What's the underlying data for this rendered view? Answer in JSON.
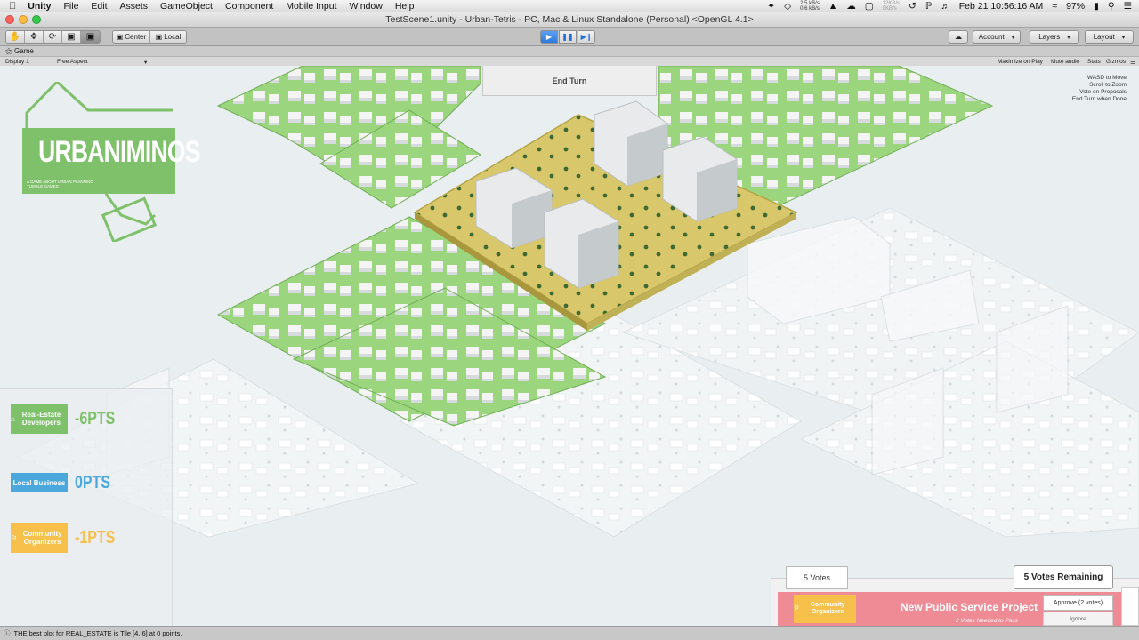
{
  "menubar": {
    "app_name": "Unity",
    "items": [
      "File",
      "Edit",
      "Assets",
      "GameObject",
      "Component",
      "Mobile Input",
      "Window",
      "Help"
    ],
    "net_up": "2.5 kB/s",
    "net_down": "0.6 kB/s",
    "disk_a": "12KB/s",
    "disk_b": "0KB/s",
    "battery": "97%",
    "datetime": "Feb 21  10:56:16 AM"
  },
  "window": {
    "title": "TestScene1.unity - Urban-Tetris - PC, Mac & Linux Standalone (Personal) <OpenGL 4.1>"
  },
  "toolbar": {
    "pivot_label": "Center",
    "space_label": "Local",
    "account_label": "Account",
    "layers_label": "Layers",
    "layout_label": "Layout",
    "tool_icons": [
      "hand-icon",
      "move-icon",
      "rotate-icon",
      "scale-icon",
      "rect-icon"
    ]
  },
  "game_view": {
    "tab_label": "Game",
    "display_label": "Display 1",
    "aspect_label": "Free Aspect",
    "maximize_label": "Maximize on Play",
    "mute_label": "Mute audio",
    "stats_label": "Stats",
    "gizmos_label": "Gizmos"
  },
  "hud": {
    "end_turn_label": "End Turn",
    "help_lines": [
      "WASD to Move",
      "Scroll to Zoom",
      "Vote on Proposals",
      "End Turn when Done"
    ],
    "logo_title": "URBANIMINOS",
    "logo_subtitle_1": "A GAME ABOUT URBAN PLANNING",
    "logo_subtitle_2": "TUMBLE GAMES"
  },
  "scores": [
    {
      "group": "Real-Estate Developers",
      "points": "-6PTS",
      "color": "#7fc06a"
    },
    {
      "group": "Local Business",
      "points": "0PTS",
      "color": "#4aa8dc"
    },
    {
      "group": "Community Organizers",
      "points": "-1PTS",
      "color": "#f6c04a"
    }
  ],
  "voting": {
    "votes_label": "5 Votes",
    "remaining_label": "5 Votes Remaining",
    "proposal_group": "Community Organizers",
    "proposal_title": "New Public Service Project",
    "proposal_need": "2 Votes Needed to Pass",
    "approve_label": "Approve (2 votes)",
    "ignore_label": "Ignore"
  },
  "status": {
    "message": "THE best plot for REAL_ESTATE is Tile [4, 6] at 0 points."
  },
  "colors": {
    "green_tile": "#98d47a",
    "plaza": "#d8c76b",
    "building": "#f3f3f3",
    "proposal_bg": "#ee8b95",
    "play_blue": "#2f79d9"
  }
}
